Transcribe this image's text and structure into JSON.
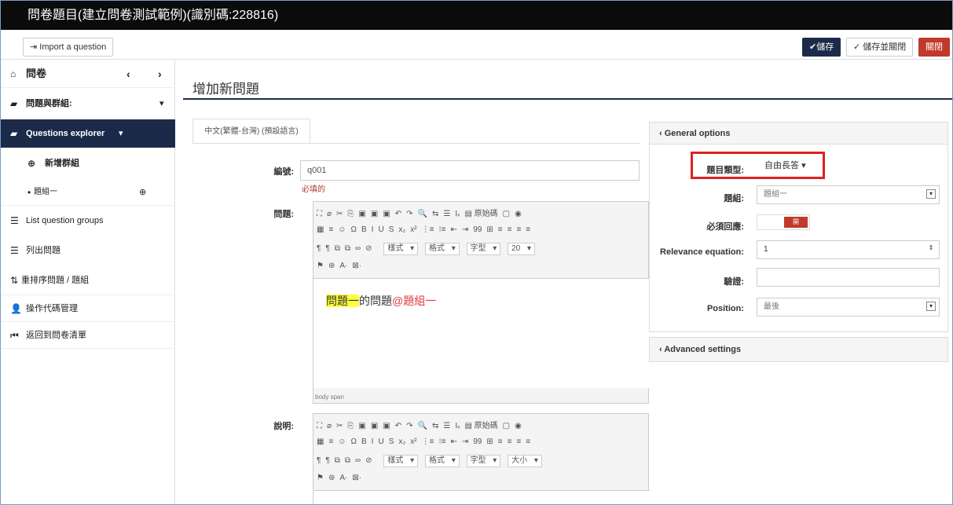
{
  "window": {
    "title": "問卷題目(建立問卷測試範例)(識別碼:228816)"
  },
  "toolbar": {
    "import_label": "Import a question",
    "save_label": "儲存",
    "save_close_label": "儲存並關閉",
    "close_label": "關閉"
  },
  "sidebar": {
    "survey_label": "問卷",
    "questions_groups_label": "問題與群組:",
    "explorer_label": "Questions explorer",
    "new_group_label": "新增群組",
    "group1_label": "題組一",
    "list_groups_label": "List question groups",
    "list_questions_label": "列出問題",
    "reorder_label": "重排序問題 / 題組",
    "token_label": "操作代碼管理",
    "back_label": "返回到問卷清單"
  },
  "main": {
    "page_title": "增加新問題",
    "language_tab": "中文(繁體-台灣) (預設語言)",
    "code_label": "編號:",
    "code_value": "q001",
    "required_note": "必填的",
    "question_label": "問題:",
    "help_label": "說明:",
    "question_text_part1": "問題一",
    "question_text_part2": "的問題",
    "question_text_part3": "@題組一",
    "editor_path": "body  span",
    "editor_toolbar": {
      "row1": [
        "⛶",
        "⌀",
        "✂",
        "⎘",
        "▣",
        "▣",
        "▣",
        "↶",
        "↷",
        "🔍",
        "⇆",
        "☰",
        "Iₓ",
        "▤ 原始碼",
        "▢",
        "◉"
      ],
      "row2": [
        "▦",
        "≡",
        "☺",
        "Ω",
        "B",
        "I",
        "U",
        "S",
        "x₂",
        "x²",
        "⋮≡",
        "⁝≡",
        "⇤",
        "⇥",
        "99",
        "⊞",
        "≡",
        "≡",
        "≡",
        "≡"
      ],
      "row3": [
        "¶",
        "¶",
        "⧉",
        "⧉",
        "∞",
        "⊘"
      ],
      "format_label": "樣式",
      "format2_label": "格式",
      "font_label": "字型",
      "size_label_q": "20",
      "size_label_h": "大小",
      "row4": [
        "⚑",
        "⊛",
        "A·",
        "⊠·"
      ]
    }
  },
  "general": {
    "header": "General options",
    "type_label": "題目類型:",
    "type_value": "自由長答",
    "group_label": "題組:",
    "group_value": "題組一",
    "mandatory_label": "必須回應:",
    "mandatory_value": "開",
    "relevance_label": "Relevance equation:",
    "relevance_value": "1",
    "validation_label": "驗證:",
    "validation_value": "",
    "position_label": "Position:",
    "position_value": "最後"
  },
  "advanced": {
    "header": "Advanced settings"
  },
  "colors": {
    "nav_active": "#1c2a4a",
    "danger": "#c0392b",
    "highlight_box": "#e02020",
    "highlight_text": "#ffff3b"
  }
}
